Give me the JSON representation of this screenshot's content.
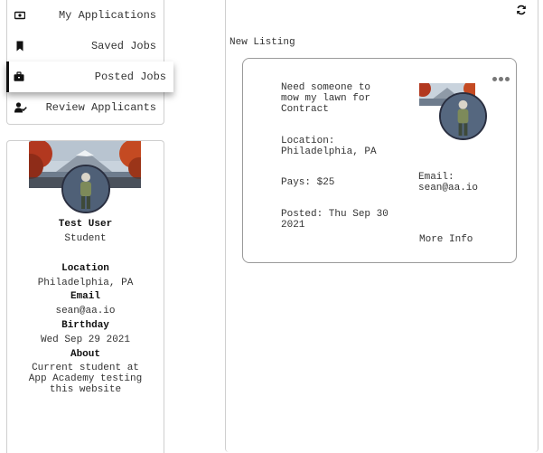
{
  "nav": {
    "items": [
      {
        "label": "My Applications",
        "icon": "money-icon"
      },
      {
        "label": "Saved Jobs",
        "icon": "bookmark-icon"
      },
      {
        "label": "Posted Jobs",
        "icon": "briefcase-icon",
        "active": true
      },
      {
        "label": "Review Applicants",
        "icon": "user-check-icon"
      }
    ]
  },
  "profile": {
    "name": "Test User",
    "role": "Student",
    "location_label": "Location",
    "location": "Philadelphia, PA",
    "email_label": "Email",
    "email": "sean@aa.io",
    "birthday_label": "Birthday",
    "birthday": "Wed Sep 29 2021",
    "about_label": "About",
    "about_lines": [
      "Current student at",
      "App Academy testing",
      "this website"
    ]
  },
  "main": {
    "section_title": "New Listing",
    "refresh_icon": "refresh-icon"
  },
  "listing": {
    "title_lines": [
      "Need someone to",
      "mow my lawn for",
      "Contract"
    ],
    "location_lines": [
      "Location:",
      "Philadelphia, PA"
    ],
    "pays": "Pays: $25",
    "email_lines": [
      "Email:",
      "sean@aa.io"
    ],
    "posted_lines": [
      "Posted: Thu Sep 30",
      "2021"
    ],
    "more_info": "More Info",
    "menu_icon": "more-dots-icon"
  },
  "colors": {
    "border": "#cfcfcf",
    "card_border": "#9a9a9a",
    "text": "#333333",
    "active_bar": "#111111"
  }
}
